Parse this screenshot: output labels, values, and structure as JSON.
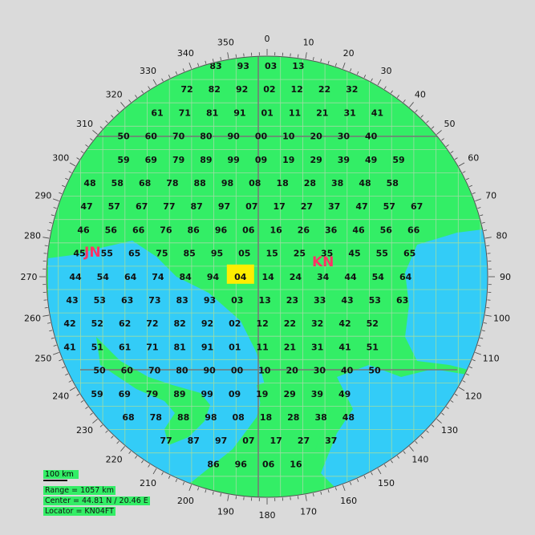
{
  "bearing_labels": [
    "0",
    "10",
    "20",
    "30",
    "40",
    "50",
    "60",
    "70",
    "80",
    "90",
    "100",
    "110",
    "120",
    "130",
    "140",
    "150",
    "160",
    "170",
    "180",
    "190",
    "200",
    "210",
    "220",
    "230",
    "240",
    "250",
    "260",
    "270",
    "280",
    "290",
    "300",
    "310",
    "320",
    "330",
    "340",
    "350"
  ],
  "field_labels": {
    "west": "JN",
    "east": "KN"
  },
  "highlighted_square": "04",
  "scale": "100 km",
  "info": {
    "range": "Range = 1057 km",
    "center": "Center = 44.81 N / 20.46 E",
    "locator": "Locator = KN04FT"
  },
  "colors": {
    "land": "#33ee66",
    "sea": "#33ccf7",
    "background": "#dadada",
    "highlight": "#ffee00",
    "field_label": "#ff3366"
  },
  "squares": [
    "83",
    "93",
    "03",
    "13",
    "72",
    "82",
    "92",
    "02",
    "12",
    "22",
    "32",
    "61",
    "71",
    "81",
    "91",
    "01",
    "11",
    "21",
    "31",
    "41",
    "50",
    "60",
    "70",
    "80",
    "90",
    "00",
    "10",
    "20",
    "30",
    "40",
    "59",
    "69",
    "79",
    "89",
    "99",
    "09",
    "19",
    "29",
    "39",
    "49",
    "59",
    "48",
    "58",
    "68",
    "78",
    "88",
    "98",
    "08",
    "18",
    "28",
    "38",
    "48",
    "58",
    "47",
    "57",
    "67",
    "77",
    "87",
    "97",
    "07",
    "17",
    "27",
    "37",
    "47",
    "57",
    "67",
    "46",
    "56",
    "66",
    "76",
    "86",
    "96",
    "06",
    "16",
    "26",
    "36",
    "46",
    "56",
    "66",
    "45",
    "55",
    "65",
    "75",
    "85",
    "95",
    "05",
    "15",
    "25",
    "35",
    "45",
    "55",
    "65",
    "44",
    "54",
    "64",
    "74",
    "84",
    "94",
    "04",
    "14",
    "24",
    "34",
    "44",
    "54",
    "64",
    "43",
    "53",
    "63",
    "73",
    "83",
    "93",
    "03",
    "13",
    "23",
    "33",
    "43",
    "53",
    "63",
    "42",
    "52",
    "62",
    "72",
    "82",
    "92",
    "02",
    "12",
    "22",
    "32",
    "42",
    "52",
    "41",
    "51",
    "61",
    "71",
    "81",
    "91",
    "01",
    "11",
    "21",
    "31",
    "41",
    "51",
    "50",
    "60",
    "70",
    "80",
    "90",
    "00",
    "10",
    "20",
    "30",
    "40",
    "50",
    "59",
    "69",
    "79",
    "89",
    "99",
    "09",
    "19",
    "29",
    "39",
    "49",
    "68",
    "78",
    "88",
    "98",
    "08",
    "18",
    "28",
    "38",
    "48",
    "77",
    "87",
    "97",
    "07",
    "17",
    "27",
    "37",
    "86",
    "96",
    "06",
    "16"
  ]
}
